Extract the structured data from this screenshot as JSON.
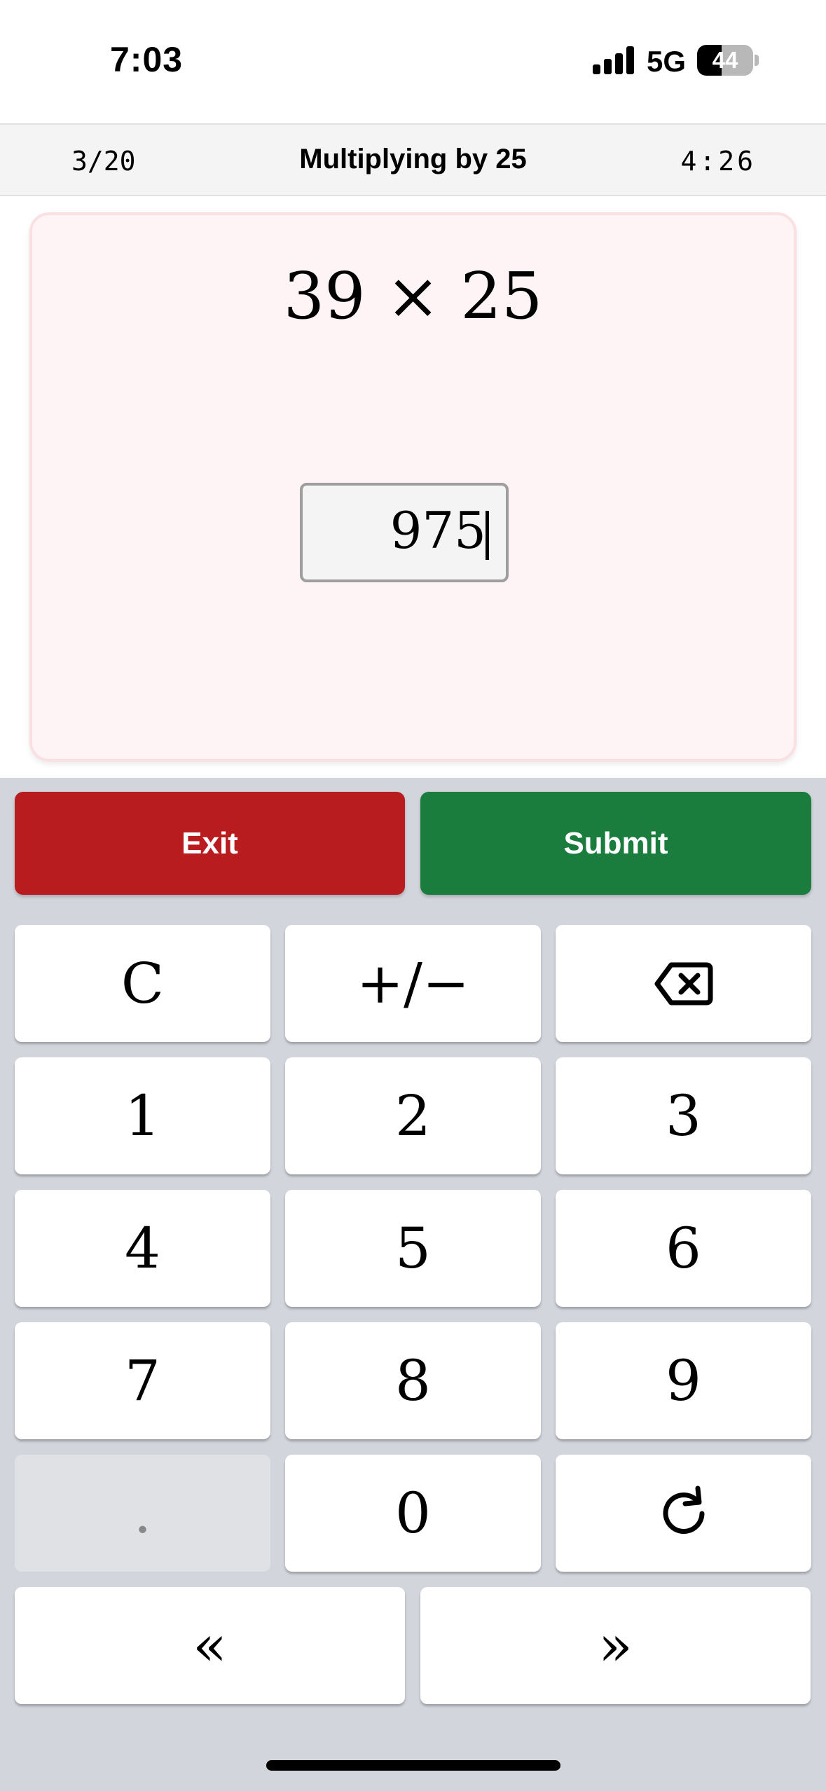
{
  "status_bar": {
    "time": "7:03",
    "network": "5G",
    "battery": "44",
    "battery_level": 0.44
  },
  "header": {
    "progress": "3/20",
    "title": "Multiplying by 25",
    "timer": "4:26"
  },
  "problem": {
    "question": "39 × 25",
    "answer_value": "975"
  },
  "actions": {
    "exit_label": "Exit",
    "submit_label": "Submit"
  },
  "keypad": {
    "clear": "C",
    "sign": "+/−",
    "backspace_icon": "backspace-icon",
    "digits": [
      "1",
      "2",
      "3",
      "4",
      "5",
      "6",
      "7",
      "8",
      "9",
      "0"
    ],
    "decimal": ".",
    "refresh_icon": "refresh-icon",
    "prev": "«",
    "next": "»"
  },
  "colors": {
    "exit": "#b81c1f",
    "submit": "#1a7d3e",
    "card_bg": "#fff4f5",
    "keypad_bg": "#d2d5dc"
  }
}
